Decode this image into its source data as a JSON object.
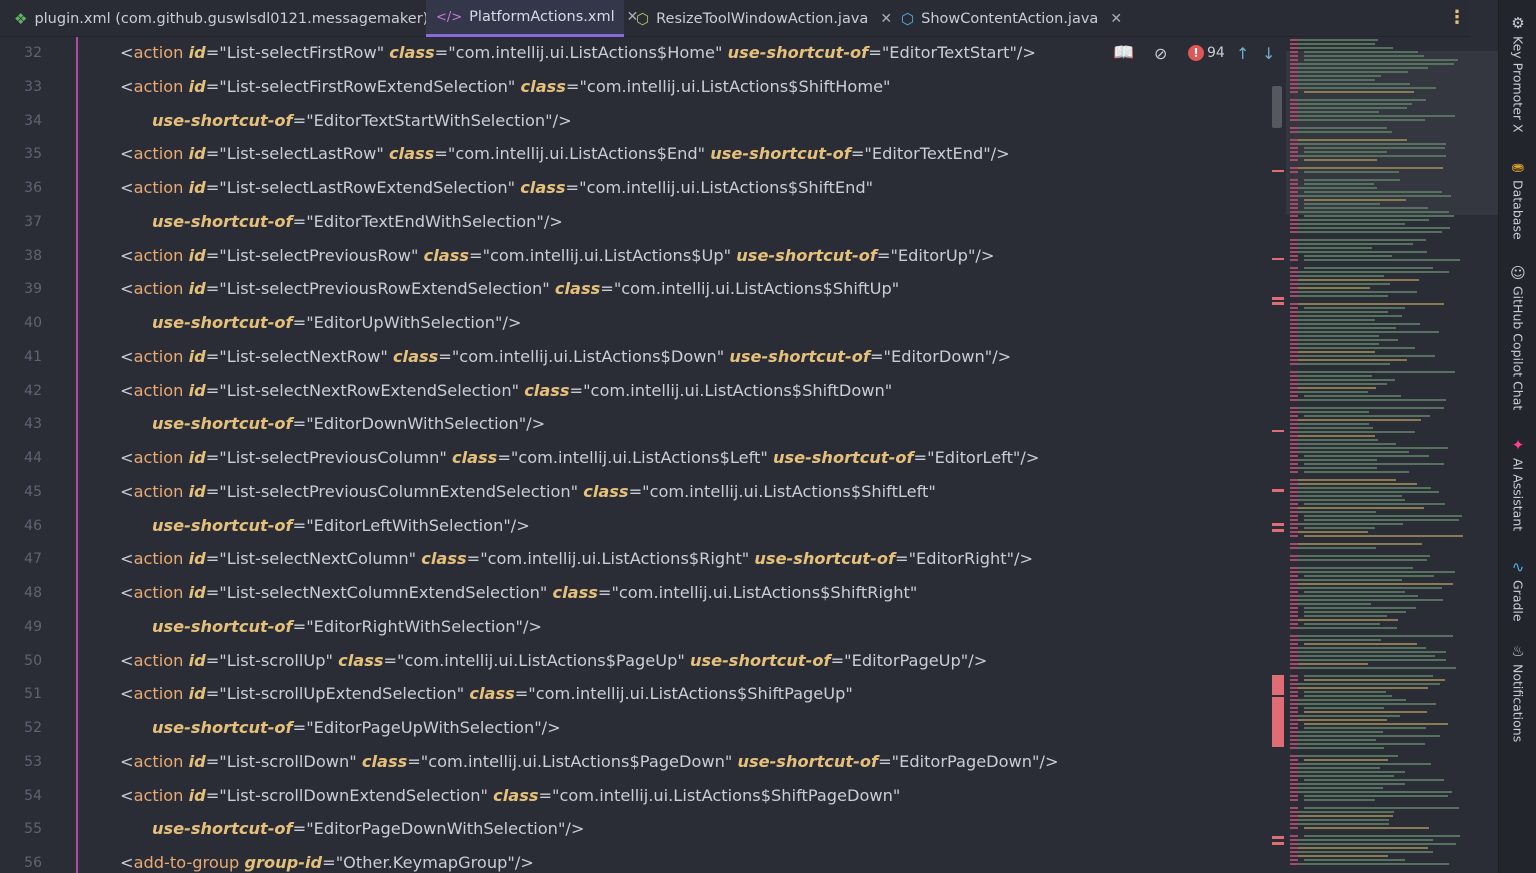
{
  "tabs": [
    {
      "label": "plugin.xml (com.github.guswlsdl0121.messagemaker)",
      "icon": "puzzle-icon"
    },
    {
      "label": "PlatformActions.xml",
      "icon": "xml-tag-icon",
      "active": true
    },
    {
      "label": "ResizeToolWindowAction.java",
      "icon": "java-class-icon"
    },
    {
      "label": "ShowContentAction.java",
      "icon": "java-class-icon"
    }
  ],
  "inspection": {
    "error_count": "94"
  },
  "tool_windows": [
    {
      "label": "Key Promoter X",
      "icon": "key-promoter-icon"
    },
    {
      "label": "Database",
      "icon": "database-icon"
    },
    {
      "label": "GitHub Copilot Chat",
      "icon": "copilot-icon"
    },
    {
      "label": "AI Assistant",
      "icon": "ai-assistant-icon"
    },
    {
      "label": "Gradle",
      "icon": "gradle-icon"
    },
    {
      "label": "Notifications",
      "icon": "bell-icon"
    }
  ],
  "lines": [
    {
      "n": "32",
      "indent": 0,
      "tokens": [
        [
          "p",
          "<"
        ],
        [
          "t",
          "action"
        ],
        [
          "p",
          " "
        ],
        [
          "a",
          "id"
        ],
        [
          "p",
          "="
        ],
        [
          "s",
          "\"List-selectFirstRow\""
        ],
        [
          "p",
          " "
        ],
        [
          "a",
          "class"
        ],
        [
          "p",
          "="
        ],
        [
          "s",
          "\"com.intellij.ui.ListActions$Home\""
        ],
        [
          "p",
          " "
        ],
        [
          "a",
          "use-shortcut-of"
        ],
        [
          "p",
          "="
        ],
        [
          "s",
          "\"EditorTextStart\""
        ],
        [
          "p",
          "/>"
        ]
      ]
    },
    {
      "n": "33",
      "indent": 0,
      "tokens": [
        [
          "p",
          "<"
        ],
        [
          "t",
          "action"
        ],
        [
          "p",
          " "
        ],
        [
          "a",
          "id"
        ],
        [
          "p",
          "="
        ],
        [
          "s",
          "\"List-selectFirstRowExtendSelection\""
        ],
        [
          "p",
          " "
        ],
        [
          "a",
          "class"
        ],
        [
          "p",
          "="
        ],
        [
          "s",
          "\"com.intellij.ui.ListActions$ShiftHome\""
        ]
      ]
    },
    {
      "n": "34",
      "indent": 1,
      "tokens": [
        [
          "a",
          "use-shortcut-of"
        ],
        [
          "p",
          "="
        ],
        [
          "s",
          "\"EditorTextStartWithSelection\""
        ],
        [
          "p",
          "/>"
        ]
      ]
    },
    {
      "n": "35",
      "indent": 0,
      "tokens": [
        [
          "p",
          "<"
        ],
        [
          "t",
          "action"
        ],
        [
          "p",
          " "
        ],
        [
          "a",
          "id"
        ],
        [
          "p",
          "="
        ],
        [
          "s",
          "\"List-selectLastRow\""
        ],
        [
          "p",
          " "
        ],
        [
          "a",
          "class"
        ],
        [
          "p",
          "="
        ],
        [
          "s",
          "\"com.intellij.ui.ListActions$End\""
        ],
        [
          "p",
          " "
        ],
        [
          "a",
          "use-shortcut-of"
        ],
        [
          "p",
          "="
        ],
        [
          "s",
          "\"EditorTextEnd\""
        ],
        [
          "p",
          "/>"
        ]
      ]
    },
    {
      "n": "36",
      "indent": 0,
      "tokens": [
        [
          "p",
          "<"
        ],
        [
          "t",
          "action"
        ],
        [
          "p",
          " "
        ],
        [
          "a",
          "id"
        ],
        [
          "p",
          "="
        ],
        [
          "s",
          "\"List-selectLastRowExtendSelection\""
        ],
        [
          "p",
          " "
        ],
        [
          "a",
          "class"
        ],
        [
          "p",
          "="
        ],
        [
          "s",
          "\"com.intellij.ui.ListActions$ShiftEnd\""
        ]
      ]
    },
    {
      "n": "37",
      "indent": 1,
      "tokens": [
        [
          "a",
          "use-shortcut-of"
        ],
        [
          "p",
          "="
        ],
        [
          "s",
          "\"EditorTextEndWithSelection\""
        ],
        [
          "p",
          "/>"
        ]
      ]
    },
    {
      "n": "38",
      "indent": 0,
      "tokens": [
        [
          "p",
          "<"
        ],
        [
          "t",
          "action"
        ],
        [
          "p",
          " "
        ],
        [
          "a",
          "id"
        ],
        [
          "p",
          "="
        ],
        [
          "s",
          "\"List-selectPreviousRow\""
        ],
        [
          "p",
          " "
        ],
        [
          "a",
          "class"
        ],
        [
          "p",
          "="
        ],
        [
          "s",
          "\"com.intellij.ui.ListActions$Up\""
        ],
        [
          "p",
          " "
        ],
        [
          "a",
          "use-shortcut-of"
        ],
        [
          "p",
          "="
        ],
        [
          "s",
          "\"EditorUp\""
        ],
        [
          "p",
          "/>"
        ]
      ]
    },
    {
      "n": "39",
      "indent": 0,
      "tokens": [
        [
          "p",
          "<"
        ],
        [
          "t",
          "action"
        ],
        [
          "p",
          " "
        ],
        [
          "a",
          "id"
        ],
        [
          "p",
          "="
        ],
        [
          "s",
          "\"List-selectPreviousRowExtendSelection\""
        ],
        [
          "p",
          " "
        ],
        [
          "a",
          "class"
        ],
        [
          "p",
          "="
        ],
        [
          "s",
          "\"com.intellij.ui.ListActions$ShiftUp\""
        ]
      ]
    },
    {
      "n": "40",
      "indent": 1,
      "tokens": [
        [
          "a",
          "use-shortcut-of"
        ],
        [
          "p",
          "="
        ],
        [
          "s",
          "\"EditorUpWithSelection\""
        ],
        [
          "p",
          "/>"
        ]
      ]
    },
    {
      "n": "41",
      "indent": 0,
      "tokens": [
        [
          "p",
          "<"
        ],
        [
          "t",
          "action"
        ],
        [
          "p",
          " "
        ],
        [
          "a",
          "id"
        ],
        [
          "p",
          "="
        ],
        [
          "s",
          "\"List-selectNextRow\""
        ],
        [
          "p",
          " "
        ],
        [
          "a",
          "class"
        ],
        [
          "p",
          "="
        ],
        [
          "s",
          "\"com.intellij.ui.ListActions$Down\""
        ],
        [
          "p",
          " "
        ],
        [
          "a",
          "use-shortcut-of"
        ],
        [
          "p",
          "="
        ],
        [
          "s",
          "\"EditorDown\""
        ],
        [
          "p",
          "/>"
        ]
      ]
    },
    {
      "n": "42",
      "indent": 0,
      "tokens": [
        [
          "p",
          "<"
        ],
        [
          "t",
          "action"
        ],
        [
          "p",
          " "
        ],
        [
          "a",
          "id"
        ],
        [
          "p",
          "="
        ],
        [
          "s",
          "\"List-selectNextRowExtendSelection\""
        ],
        [
          "p",
          " "
        ],
        [
          "a",
          "class"
        ],
        [
          "p",
          "="
        ],
        [
          "s",
          "\"com.intellij.ui.ListActions$ShiftDown\""
        ]
      ]
    },
    {
      "n": "43",
      "indent": 1,
      "tokens": [
        [
          "a",
          "use-shortcut-of"
        ],
        [
          "p",
          "="
        ],
        [
          "s",
          "\"EditorDownWithSelection\""
        ],
        [
          "p",
          "/>"
        ]
      ]
    },
    {
      "n": "44",
      "indent": 0,
      "tokens": [
        [
          "p",
          "<"
        ],
        [
          "t",
          "action"
        ],
        [
          "p",
          " "
        ],
        [
          "a",
          "id"
        ],
        [
          "p",
          "="
        ],
        [
          "s",
          "\"List-selectPreviousColumn\""
        ],
        [
          "p",
          " "
        ],
        [
          "a",
          "class"
        ],
        [
          "p",
          "="
        ],
        [
          "s",
          "\"com.intellij.ui.ListActions$Left\""
        ],
        [
          "p",
          " "
        ],
        [
          "a",
          "use-shortcut-of"
        ],
        [
          "p",
          "="
        ],
        [
          "s",
          "\"EditorLeft\""
        ],
        [
          "p",
          "/>"
        ]
      ]
    },
    {
      "n": "45",
      "indent": 0,
      "tokens": [
        [
          "p",
          "<"
        ],
        [
          "t",
          "action"
        ],
        [
          "p",
          " "
        ],
        [
          "a",
          "id"
        ],
        [
          "p",
          "="
        ],
        [
          "s",
          "\"List-selectPreviousColumnExtendSelection\""
        ],
        [
          "p",
          " "
        ],
        [
          "a",
          "class"
        ],
        [
          "p",
          "="
        ],
        [
          "s",
          "\"com.intellij.ui.ListActions$ShiftLeft\""
        ]
      ]
    },
    {
      "n": "46",
      "indent": 1,
      "tokens": [
        [
          "a",
          "use-shortcut-of"
        ],
        [
          "p",
          "="
        ],
        [
          "s",
          "\"EditorLeftWithSelection\""
        ],
        [
          "p",
          "/>"
        ]
      ]
    },
    {
      "n": "47",
      "indent": 0,
      "tokens": [
        [
          "p",
          "<"
        ],
        [
          "t",
          "action"
        ],
        [
          "p",
          " "
        ],
        [
          "a",
          "id"
        ],
        [
          "p",
          "="
        ],
        [
          "s",
          "\"List-selectNextColumn\""
        ],
        [
          "p",
          " "
        ],
        [
          "a",
          "class"
        ],
        [
          "p",
          "="
        ],
        [
          "s",
          "\"com.intellij.ui.ListActions$Right\""
        ],
        [
          "p",
          " "
        ],
        [
          "a",
          "use-shortcut-of"
        ],
        [
          "p",
          "="
        ],
        [
          "s",
          "\"EditorRight\""
        ],
        [
          "p",
          "/>"
        ]
      ]
    },
    {
      "n": "48",
      "indent": 0,
      "tokens": [
        [
          "p",
          "<"
        ],
        [
          "t",
          "action"
        ],
        [
          "p",
          " "
        ],
        [
          "a",
          "id"
        ],
        [
          "p",
          "="
        ],
        [
          "s",
          "\"List-selectNextColumnExtendSelection\""
        ],
        [
          "p",
          " "
        ],
        [
          "a",
          "class"
        ],
        [
          "p",
          "="
        ],
        [
          "s",
          "\"com.intellij.ui.ListActions$ShiftRight\""
        ]
      ]
    },
    {
      "n": "49",
      "indent": 1,
      "tokens": [
        [
          "a",
          "use-shortcut-of"
        ],
        [
          "p",
          "="
        ],
        [
          "s",
          "\"EditorRightWithSelection\""
        ],
        [
          "p",
          "/>"
        ]
      ]
    },
    {
      "n": "50",
      "indent": 0,
      "tokens": [
        [
          "p",
          "<"
        ],
        [
          "t",
          "action"
        ],
        [
          "p",
          " "
        ],
        [
          "a",
          "id"
        ],
        [
          "p",
          "="
        ],
        [
          "s",
          "\"List-scrollUp\""
        ],
        [
          "p",
          " "
        ],
        [
          "a",
          "class"
        ],
        [
          "p",
          "="
        ],
        [
          "s",
          "\"com.intellij.ui.ListActions$PageUp\""
        ],
        [
          "p",
          " "
        ],
        [
          "a",
          "use-shortcut-of"
        ],
        [
          "p",
          "="
        ],
        [
          "s",
          "\"EditorPageUp\""
        ],
        [
          "p",
          "/>"
        ]
      ]
    },
    {
      "n": "51",
      "indent": 0,
      "tokens": [
        [
          "p",
          "<"
        ],
        [
          "t",
          "action"
        ],
        [
          "p",
          " "
        ],
        [
          "a",
          "id"
        ],
        [
          "p",
          "="
        ],
        [
          "s",
          "\"List-scrollUpExtendSelection\""
        ],
        [
          "p",
          " "
        ],
        [
          "a",
          "class"
        ],
        [
          "p",
          "="
        ],
        [
          "s",
          "\"com.intellij.ui.ListActions$ShiftPageUp\""
        ]
      ]
    },
    {
      "n": "52",
      "indent": 1,
      "tokens": [
        [
          "a",
          "use-shortcut-of"
        ],
        [
          "p",
          "="
        ],
        [
          "s",
          "\"EditorPageUpWithSelection\""
        ],
        [
          "p",
          "/>"
        ]
      ]
    },
    {
      "n": "53",
      "indent": 0,
      "tokens": [
        [
          "p",
          "<"
        ],
        [
          "t",
          "action"
        ],
        [
          "p",
          " "
        ],
        [
          "a",
          "id"
        ],
        [
          "p",
          "="
        ],
        [
          "s",
          "\"List-scrollDown\""
        ],
        [
          "p",
          " "
        ],
        [
          "a",
          "class"
        ],
        [
          "p",
          "="
        ],
        [
          "s",
          "\"com.intellij.ui.ListActions$PageDown\""
        ],
        [
          "p",
          " "
        ],
        [
          "a",
          "use-shortcut-of"
        ],
        [
          "p",
          "="
        ],
        [
          "s",
          "\"EditorPageDown\""
        ],
        [
          "p",
          "/>"
        ]
      ]
    },
    {
      "n": "54",
      "indent": 0,
      "tokens": [
        [
          "p",
          "<"
        ],
        [
          "t",
          "action"
        ],
        [
          "p",
          " "
        ],
        [
          "a",
          "id"
        ],
        [
          "p",
          "="
        ],
        [
          "s",
          "\"List-scrollDownExtendSelection\""
        ],
        [
          "p",
          " "
        ],
        [
          "a",
          "class"
        ],
        [
          "p",
          "="
        ],
        [
          "s",
          "\"com.intellij.ui.ListActions$ShiftPageDown\""
        ]
      ]
    },
    {
      "n": "55",
      "indent": 1,
      "tokens": [
        [
          "a",
          "use-shortcut-of"
        ],
        [
          "p",
          "="
        ],
        [
          "s",
          "\"EditorPageDownWithSelection\""
        ],
        [
          "p",
          "/>"
        ]
      ]
    },
    {
      "n": "56",
      "indent": 0,
      "tokens": [
        [
          "p",
          "<"
        ],
        [
          "t",
          "add-to-group"
        ],
        [
          "p",
          " "
        ],
        [
          "a",
          "group-id"
        ],
        [
          "p",
          "="
        ],
        [
          "s",
          "\"Other.KeymapGroup\""
        ],
        [
          "p",
          "/>"
        ]
      ]
    }
  ]
}
